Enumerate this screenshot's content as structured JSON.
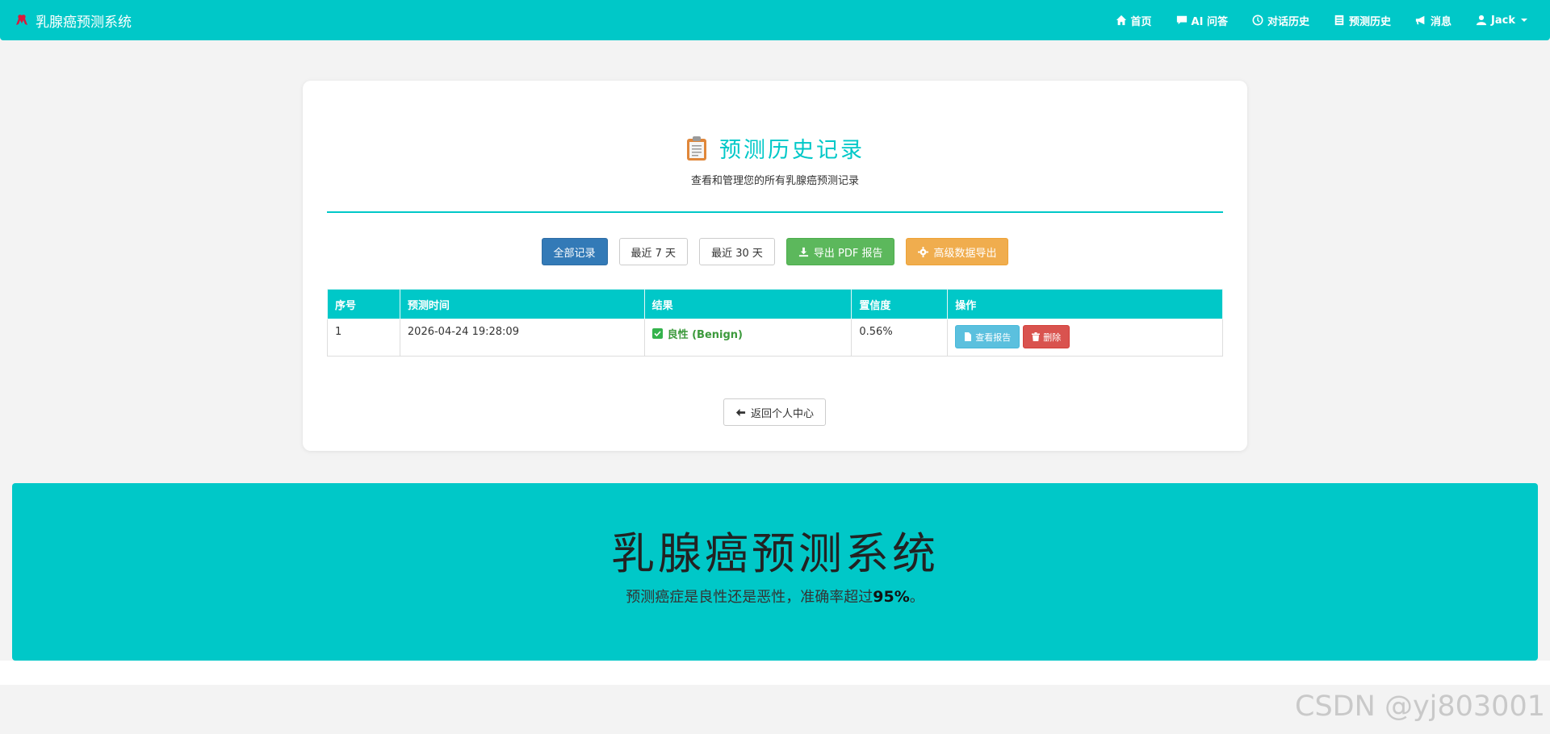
{
  "navbar": {
    "brand": "乳腺癌预测系统",
    "links": [
      {
        "label": "首页",
        "icon": "home-icon"
      },
      {
        "label": "AI 问答",
        "icon": "comment-icon"
      },
      {
        "label": "对话历史",
        "icon": "clock-icon"
      },
      {
        "label": "预测历史",
        "icon": "list-icon"
      },
      {
        "label": "消息",
        "icon": "bullhorn-icon"
      },
      {
        "label": "Jack",
        "icon": "user-icon"
      }
    ]
  },
  "page": {
    "title": "预测历史记录",
    "subtitle": "查看和管理您的所有乳腺癌预测记录"
  },
  "filters": {
    "all": "全部记录",
    "last7": "最近 7 天",
    "last30": "最近 30 天",
    "export_pdf": "导出 PDF 报告",
    "advanced_export": "高级数据导出"
  },
  "table": {
    "headers": [
      "序号",
      "预测时间",
      "结果",
      "置信度",
      "操作"
    ],
    "rows": [
      {
        "index": "1",
        "time": "2026-04-24 19:28:09",
        "result": "良性 (Benign)",
        "confidence": "0.56%",
        "view": "查看报告",
        "delete": "删除"
      }
    ]
  },
  "back_button": "返回个人中心",
  "hero": {
    "title": "乳腺癌预测系统",
    "subtitle_prefix": "预测癌症是良性还是恶性，准确率超过",
    "subtitle_value": "95%",
    "subtitle_suffix": "。"
  },
  "watermark": "CSDN @yj803001",
  "colors": {
    "accent": "#00c8c8",
    "primary": "#337ab7",
    "success": "#5cb85c",
    "warning": "#f0ad4e",
    "info": "#5bc0de",
    "danger": "#d9534f"
  }
}
